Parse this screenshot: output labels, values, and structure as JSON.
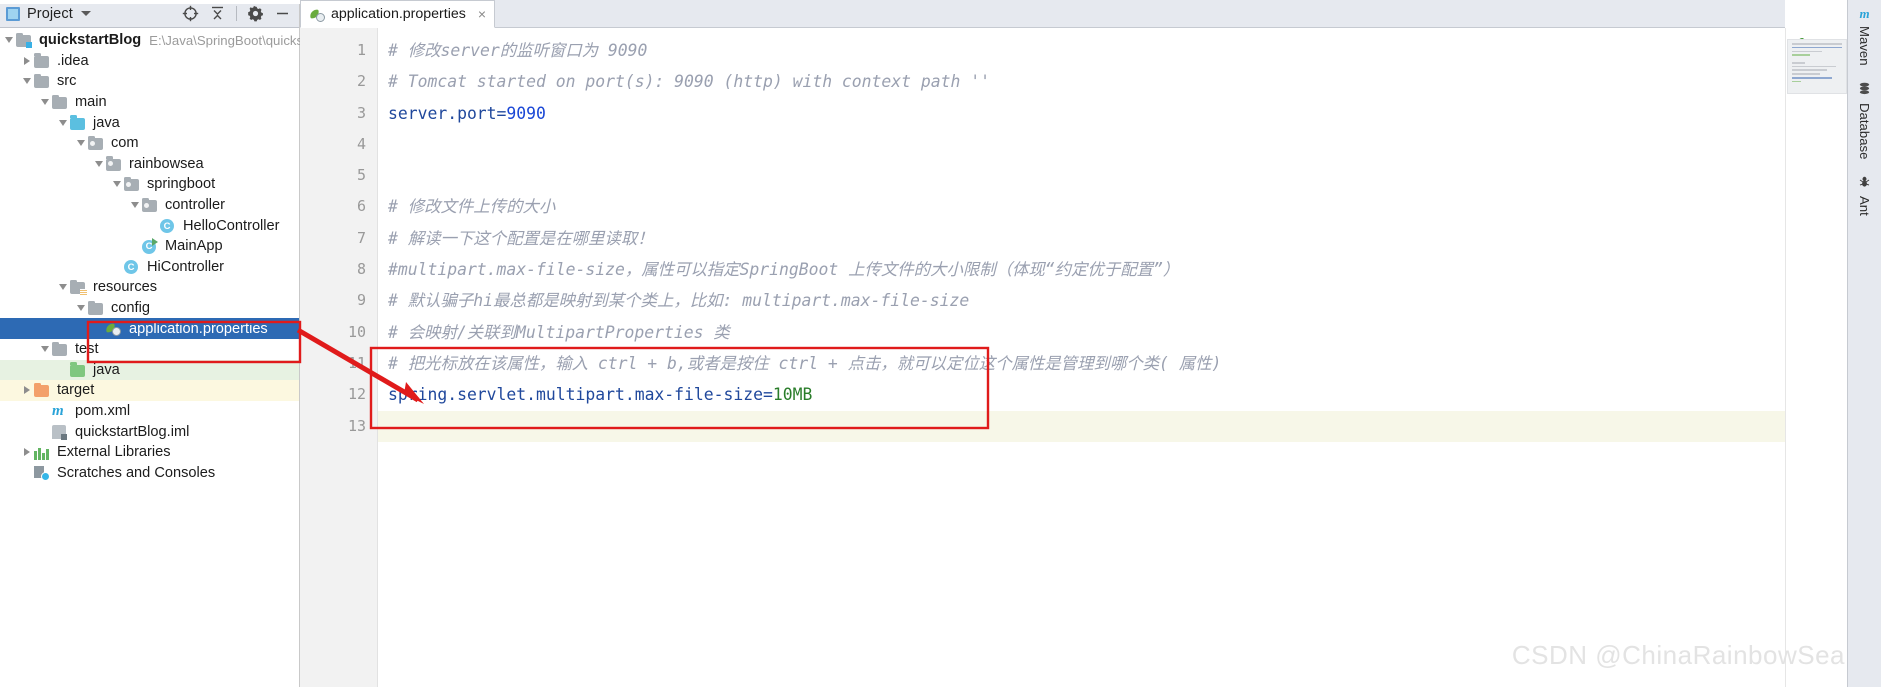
{
  "window": {
    "project_panel_title": "Project",
    "watermark": "CSDN @ChinaRainbowSea"
  },
  "toolbar": {
    "locate_icon": "crosshair-target-icon",
    "collapse_icon": "collapse-all-icon",
    "settings_icon": "gear-icon",
    "hide_icon": "minimize-icon"
  },
  "tree": {
    "items": [
      {
        "label": "quickstartBlog",
        "path": "E:\\Java\\SpringBoot\\quicksta",
        "icon": "module-folder-icon",
        "depth": 0,
        "arrow": "down",
        "bold": true,
        "state": "normal"
      },
      {
        "label": ".idea",
        "icon": "folder-icon",
        "depth": 1,
        "arrow": "right",
        "bold": false,
        "state": "normal"
      },
      {
        "label": "src",
        "icon": "folder-icon",
        "depth": 1,
        "arrow": "down",
        "bold": false,
        "state": "normal"
      },
      {
        "label": "main",
        "icon": "folder-icon",
        "depth": 2,
        "arrow": "down",
        "bold": false,
        "state": "normal"
      },
      {
        "label": "java",
        "icon": "source-folder-icon",
        "depth": 3,
        "arrow": "down",
        "bold": false,
        "state": "normal"
      },
      {
        "label": "com",
        "icon": "package-icon",
        "depth": 4,
        "arrow": "down",
        "bold": false,
        "state": "normal"
      },
      {
        "label": "rainbowsea",
        "icon": "package-icon",
        "depth": 5,
        "arrow": "down",
        "bold": false,
        "state": "normal"
      },
      {
        "label": "springboot",
        "icon": "package-icon",
        "depth": 6,
        "arrow": "down",
        "bold": false,
        "state": "normal"
      },
      {
        "label": "controller",
        "icon": "package-icon",
        "depth": 7,
        "arrow": "down",
        "bold": false,
        "state": "normal"
      },
      {
        "label": "HelloController",
        "icon": "java-class-icon",
        "depth": 8,
        "arrow": "none",
        "bold": false,
        "state": "normal"
      },
      {
        "label": "MainApp",
        "icon": "java-runnable-class-icon",
        "depth": 7,
        "arrow": "none",
        "bold": false,
        "state": "normal"
      },
      {
        "label": "HiController",
        "icon": "java-class-icon",
        "depth": 6,
        "arrow": "none",
        "bold": false,
        "state": "normal"
      },
      {
        "label": "resources",
        "icon": "resources-folder-icon",
        "depth": 3,
        "arrow": "down",
        "bold": false,
        "state": "normal"
      },
      {
        "label": "config",
        "icon": "folder-icon",
        "depth": 4,
        "arrow": "down",
        "bold": false,
        "state": "normal"
      },
      {
        "label": "application.properties",
        "icon": "spring-properties-icon",
        "depth": 5,
        "arrow": "none",
        "bold": false,
        "state": "selected"
      },
      {
        "label": "test",
        "icon": "folder-icon",
        "depth": 2,
        "arrow": "down",
        "bold": false,
        "state": "normal"
      },
      {
        "label": "java",
        "icon": "test-source-folder-icon",
        "depth": 3,
        "arrow": "none",
        "bold": false,
        "state": "green"
      },
      {
        "label": "target",
        "icon": "excluded-folder-icon",
        "depth": 1,
        "arrow": "right",
        "bold": false,
        "state": "yellow"
      },
      {
        "label": "pom.xml",
        "icon": "maven-pom-icon",
        "depth": 2,
        "arrow": "none",
        "bold": false,
        "state": "normal"
      },
      {
        "label": "quickstartBlog.iml",
        "icon": "iml-module-icon",
        "depth": 2,
        "arrow": "none",
        "bold": false,
        "state": "normal"
      },
      {
        "label": "External Libraries",
        "icon": "libraries-icon",
        "depth": 1,
        "arrow": "right",
        "bold": false,
        "state": "normal"
      },
      {
        "label": "Scratches and Consoles",
        "icon": "scratches-icon",
        "depth": 1,
        "arrow": "none",
        "bold": false,
        "state": "normal"
      }
    ]
  },
  "editor": {
    "tab": {
      "label": "application.properties",
      "icon": "spring-properties-icon",
      "close_label": "×"
    },
    "lines": [
      {
        "num": "1",
        "segments": [
          {
            "t": "# 修改server的监听窗口为 9090",
            "c": "cmt"
          }
        ],
        "highlight": false
      },
      {
        "num": "2",
        "segments": [
          {
            "t": "# Tomcat started on port(s): 9090 (http) with context path ''",
            "c": "cmt"
          }
        ],
        "highlight": false
      },
      {
        "num": "3",
        "segments": [
          {
            "t": "server.port=",
            "c": "key"
          },
          {
            "t": "9090",
            "c": "num"
          }
        ],
        "highlight": false
      },
      {
        "num": "4",
        "segments": [],
        "highlight": false
      },
      {
        "num": "5",
        "segments": [],
        "highlight": false
      },
      {
        "num": "6",
        "segments": [
          {
            "t": "# 修改文件上传的大小",
            "c": "cmt"
          }
        ],
        "highlight": false
      },
      {
        "num": "7",
        "segments": [
          {
            "t": "# 解读一下这个配置是在哪里读取！",
            "c": "cmt"
          }
        ],
        "highlight": false
      },
      {
        "num": "8",
        "segments": [
          {
            "t": "#multipart.max-file-size，属性可以指定SpringBoot 上传文件的大小限制（体现“约定优于配置”）",
            "c": "cmt"
          }
        ],
        "highlight": false
      },
      {
        "num": "9",
        "segments": [
          {
            "t": "# 默认骗子hi最总都是映射到某个类上，比如: multipart.max-file-size",
            "c": "cmt"
          }
        ],
        "highlight": false
      },
      {
        "num": "10",
        "segments": [
          {
            "t": "# 会映射/关联到MultipartProperties 类",
            "c": "cmt"
          }
        ],
        "highlight": false
      },
      {
        "num": "11",
        "segments": [
          {
            "t": "# 把光标放在该属性，输入 ctrl + b,或者是按住 ctrl + 点击，就可以定位这个属性是管理到哪个类( 属性)",
            "c": "cmt"
          }
        ],
        "highlight": false
      },
      {
        "num": "12",
        "segments": [
          {
            "t": "spring.servlet.multipart.max-file-size=",
            "c": "key"
          },
          {
            "t": "10MB",
            "c": "grn"
          }
        ],
        "highlight": false
      },
      {
        "num": "13",
        "segments": [],
        "highlight": true
      }
    ]
  },
  "annotations": {
    "box_color": "#e01b1b",
    "arrow_color": "#e01b1b",
    "sidebar_box_label": "config-selection-highlight-box",
    "code_box_label": "multipart-property-highlight-box",
    "arrow_label": "pointer-arrow-from-line-10-to-line-12"
  },
  "status": {
    "inspection_icon": "green-check-icon",
    "inspection_state": "ok"
  },
  "tool_tabs": [
    {
      "label": "Maven",
      "icon": "maven-icon"
    },
    {
      "label": "Database",
      "icon": "database-icon"
    },
    {
      "label": "Ant",
      "icon": "ant-icon"
    }
  ]
}
